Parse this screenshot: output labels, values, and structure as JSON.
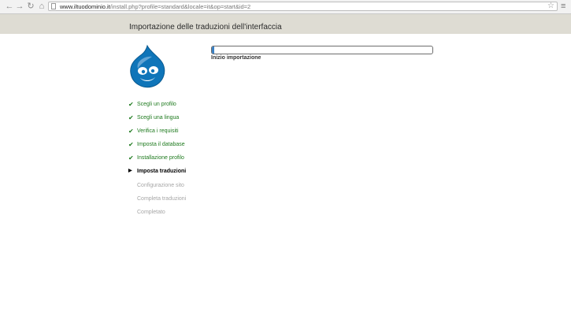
{
  "browser": {
    "url_host": "www.iltuodominio.it",
    "url_rest": "/install.php?profile=standard&locale=it&op=start&id=2",
    "back_icon": "arrow-left-icon",
    "forward_icon": "arrow-right-icon",
    "reload_icon": "reload-icon",
    "home_icon": "home-icon",
    "star_icon": "star-icon",
    "menu_icon": "menu-icon"
  },
  "page": {
    "title": "Importazione delle traduzioni dell'interfaccia",
    "logo": "drupal-logo",
    "header_color": "#dedcd3"
  },
  "progress": {
    "percent": 1,
    "message": "Inizio importazione",
    "bar_color": "#3a80c3"
  },
  "steps": [
    {
      "label": "Scegli un profilo",
      "status": "done",
      "mark": "✔"
    },
    {
      "label": "Scegli una lingua",
      "status": "done",
      "mark": "✔"
    },
    {
      "label": "Verifica i requisiti",
      "status": "done",
      "mark": "✔"
    },
    {
      "label": "Imposta il database",
      "status": "done",
      "mark": "✔"
    },
    {
      "label": "Installazione profilo",
      "status": "done",
      "mark": "✔"
    },
    {
      "label": "Imposta traduzioni",
      "status": "active",
      "mark": "▶"
    },
    {
      "label": "Configurazione sito",
      "status": "pending",
      "mark": ""
    },
    {
      "label": "Completa traduzioni",
      "status": "pending",
      "mark": ""
    },
    {
      "label": "Completato",
      "status": "pending",
      "mark": ""
    }
  ]
}
